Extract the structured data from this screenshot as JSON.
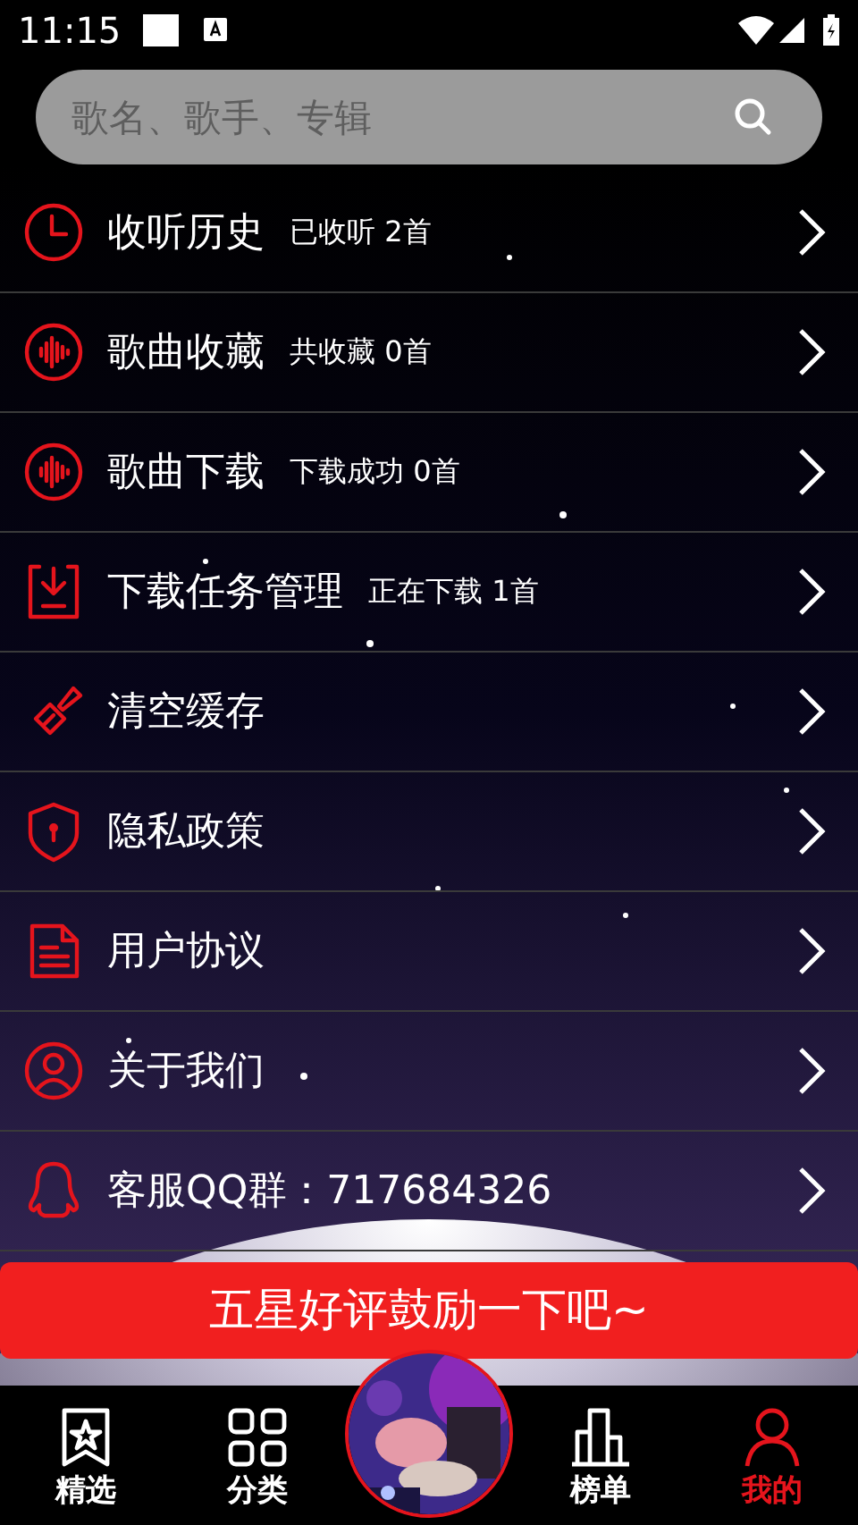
{
  "status_bar": {
    "time": "11:15"
  },
  "search": {
    "placeholder": "歌名、歌手、专辑"
  },
  "menu": [
    {
      "label": "收听历史",
      "detail": "已收听 2首"
    },
    {
      "label": "歌曲收藏",
      "detail": "共收藏 0首"
    },
    {
      "label": "歌曲下载",
      "detail": "下载成功 0首"
    },
    {
      "label": "下载任务管理",
      "detail": "正在下载 1首"
    },
    {
      "label": "清空缓存"
    },
    {
      "label": "隐私政策"
    },
    {
      "label": "用户协议"
    },
    {
      "label": "关于我们"
    },
    {
      "label": "客服QQ群：717684326"
    }
  ],
  "banner": {
    "label": "五星好评鼓励一下吧~"
  },
  "bottom_nav": [
    {
      "label": "精选",
      "selected": false
    },
    {
      "label": "分类",
      "selected": false
    },
    {
      "kind": "picture"
    },
    {
      "label": "榜单",
      "selected": false
    },
    {
      "label": "我的",
      "selected": true
    }
  ]
}
